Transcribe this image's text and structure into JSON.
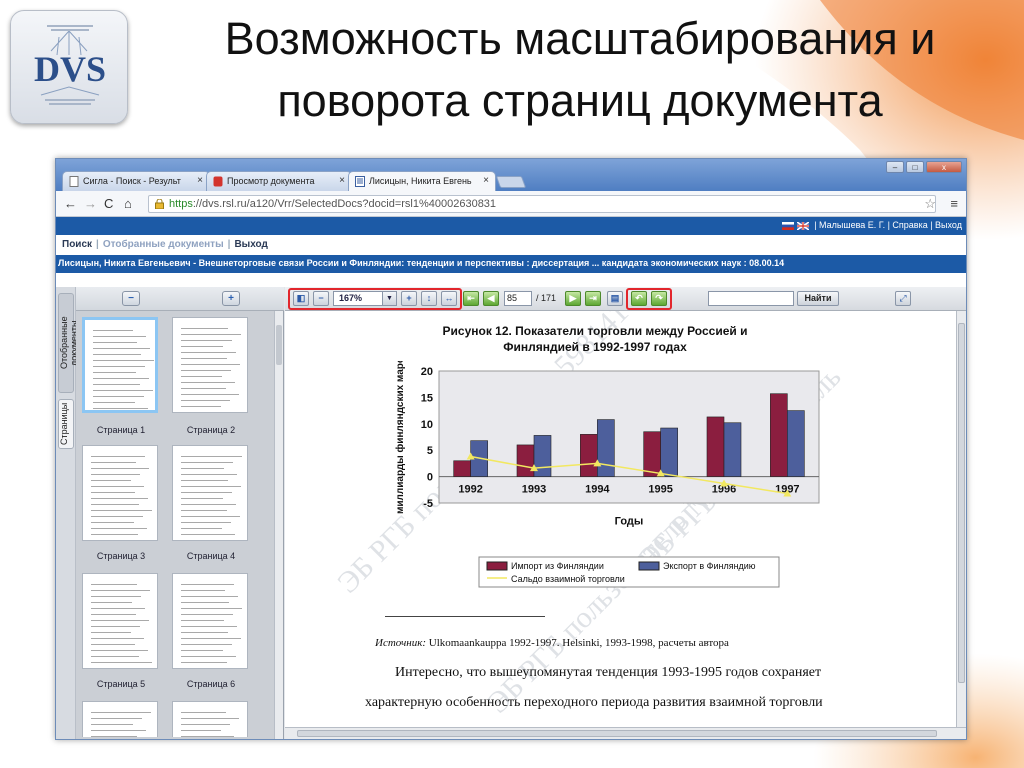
{
  "slide": {
    "title_line1": "Возможность масштабирования и",
    "title_line2": "поворота страниц документа",
    "logo_text": "DVS",
    "accent_color": "#e9722a"
  },
  "browser": {
    "tabs": [
      {
        "label": "Сигла - Поиск - Результ",
        "active": false
      },
      {
        "label": "Просмотр документа",
        "active": false
      },
      {
        "label": "Лисицын, Никита Евгень",
        "active": true
      }
    ],
    "url_https": "https",
    "url_rest": "://dvs.rsl.ru/a120/Vrr/SelectedDocs?docid=rsl1%40002630831"
  },
  "app": {
    "user_links": "| Малышева Е. Г.  | Справка | Выход",
    "nav": {
      "search": "Поиск",
      "selected": "Отобранные документы",
      "exit": "Выход"
    },
    "doc_title": "Лисицын, Никита Евгеньевич - Внешнеторговые связи России и Финляндии: тенденции и перспективы : диссертация ... кандидата экономических наук : 08.00.14"
  },
  "sidebar": {
    "tabs": [
      "Отобранные документы",
      "Страницы"
    ],
    "thumbnails": [
      "Страница 1",
      "Страница 2",
      "Страница 3",
      "Страница 4",
      "Страница 5",
      "Страница 6"
    ]
  },
  "toolbar": {
    "zoom": "167%",
    "page_current": "85",
    "page_total": "/ 171",
    "find_label": "Найти"
  },
  "page": {
    "chart_title_line1": "Рисунок 12. Показатели торговли между Россией и",
    "chart_title_line2": "Финляндией в 1992-1997 годах",
    "source_label": "Источник:",
    "source_text": "Ulkomaankauppa 1992-1997. Helsinki, 1993-1998, расчеты автора",
    "para_line1": "Интересно, что вышеупомянутая тенденция 1993-1995 годов сохраняет",
    "para_line2": "характерную особенность переходного периода развития взаимной торговли"
  },
  "chart_data": {
    "type": "bar",
    "categories": [
      "1992",
      "1993",
      "1994",
      "1995",
      "1996",
      "1997"
    ],
    "series": [
      {
        "name": "Импорт из Финляндии",
        "type": "bar",
        "color": "#8b1e3f",
        "values": [
          3.0,
          6.0,
          8.0,
          8.5,
          11.3,
          15.7
        ]
      },
      {
        "name": "Экспорт в Финляндию",
        "type": "bar",
        "color": "#4d5f9c",
        "values": [
          6.8,
          7.8,
          10.8,
          9.2,
          10.2,
          12.5
        ]
      },
      {
        "name": "Сальдо взаимной торговли",
        "type": "line",
        "color": "#f2e860",
        "values": [
          3.8,
          1.6,
          2.5,
          0.6,
          -1.3,
          -3.2
        ]
      }
    ],
    "xlabel": "Годы",
    "ylabel": "миллиарды финляндских марок",
    "ylim": [
      -5,
      20
    ],
    "yticks": [
      -5,
      0,
      5,
      10,
      15,
      20
    ],
    "legend_position": "bottom",
    "grid": false
  }
}
